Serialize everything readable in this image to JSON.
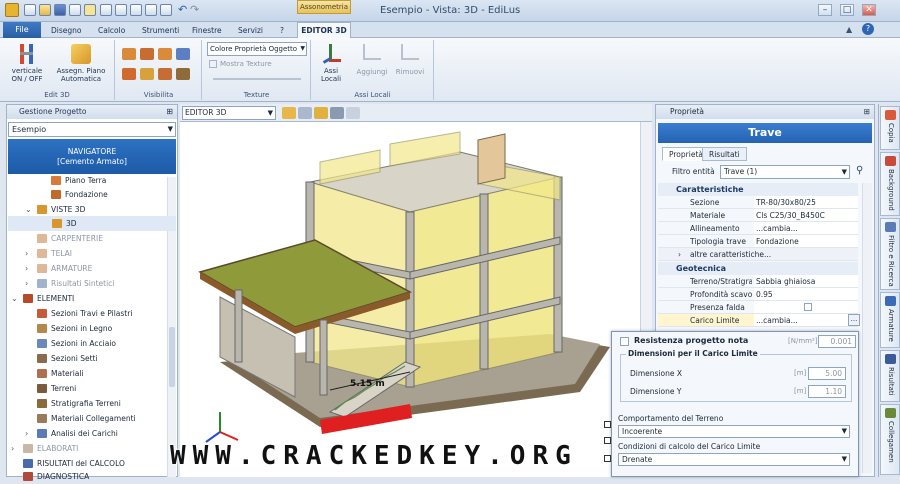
{
  "app": {
    "title": "Esempio - Vista: 3D - EdiLus",
    "context_tab": "Assonometria"
  },
  "menu_tabs": [
    "File",
    "Disegno",
    "Calcolo",
    "Strumenti",
    "Finestre",
    "Servizi",
    "?",
    "EDITOR 3D"
  ],
  "ribbon": {
    "edit3d": {
      "btn1": "verticale ON / OFF",
      "btn2": "Assegn. Piano Automatica",
      "label": "Edit 3D"
    },
    "visibilita": {
      "label": "Visibilita"
    },
    "texture": {
      "dropdown": "Colore Proprietà Oggetto",
      "check": "Mostra Texture",
      "label": "Texture"
    },
    "assi": {
      "btn1": "Assi Locali",
      "btn2": "Aggiungi",
      "btn3": "Rimuovi",
      "label": "Assi Locali"
    }
  },
  "left_panel": {
    "title": "Gestione Progetto",
    "selector": "Esempio",
    "navigator_line1": "NAVIGATORE",
    "navigator_line2": "[Cemento Armato]",
    "tree": {
      "piano_terra": "Piano Terra",
      "fondazione": "Fondazione",
      "viste3d": "VISTE 3D",
      "v3d": "3D",
      "carpenterie": "CARPENTERIE",
      "telai": "TELAI",
      "armature": "ARMATURE",
      "risultati_sintetici": "Risultati Sintetici",
      "elementi": "ELEMENTI",
      "sez_travi": "Sezioni Travi e Pilastri",
      "sez_legno": "Sezioni in Legno",
      "sez_acciaio": "Sezioni in Acciaio",
      "sez_setti": "Sezioni Setti",
      "materiali": "Materiali",
      "terreni": "Terreni",
      "stratigrafia": "Stratigrafia Terreni",
      "mat_collegamenti": "Materiali Collegamenti",
      "analisi_carichi": "Analisi dei Carichi",
      "elaborati": "ELABORATI",
      "risultati_calcolo": "RISULTATI del CALCOLO",
      "diagnostica": "DIAGNOSTICA"
    }
  },
  "viewport": {
    "selector": "EDITOR 3D",
    "dimension_label": "5.15 m"
  },
  "properties": {
    "panel_title": "Proprietà",
    "title": "Trave",
    "tabs": [
      "Proprietà",
      "Risultati"
    ],
    "filter_label": "Filtro entità",
    "filter_value": "Trave (1)",
    "section1": "Caratteristiche",
    "rows1": [
      {
        "k": "Sezione",
        "v": "TR-80/30x80/25"
      },
      {
        "k": "Materiale",
        "v": "Cls C25/30_B450C"
      },
      {
        "k": "Allineamento",
        "v": "...cambia..."
      },
      {
        "k": "Tipologia trave",
        "v": "Fondazione"
      }
    ],
    "more": "altre caratteristiche...",
    "section2": "Geotecnica",
    "rows2": [
      {
        "k": "Terreno/Stratigrafi",
        "v": "Sabbia ghiaiosa"
      },
      {
        "k": "Profondità scavo ri",
        "v": "0.95"
      },
      {
        "k": "Presenza falda",
        "v": ""
      },
      {
        "k": "Carico Limite",
        "v": "...cambia..."
      }
    ]
  },
  "popup": {
    "resistenza": "Resistenza progetto nota",
    "resistenza_unit": "[N/mm²]",
    "resistenza_val": "0.001",
    "group": "Dimensioni per il Carico Limite",
    "dimx": "Dimensione X",
    "dimx_unit": "[m]",
    "dimx_val": "5.00",
    "dimy": "Dimensione Y",
    "dimy_unit": "[m]",
    "dimy_val": "1.10",
    "comportamento": "Comportamento del Terreno",
    "comportamento_val": "Incoerente",
    "condizioni": "Condizioni di calcolo del Carico Limite",
    "condizioni_val": "Drenate"
  },
  "side_tabs": [
    "Copia",
    "Background",
    "Filtro e Ricerca",
    "Armature",
    "Risultati",
    "Collegamen"
  ],
  "watermark": "WWW.CRACKEDKEY.ORG",
  "colors": {
    "accent": "#2b6cc0",
    "wall_yellow": "#f2e88a",
    "slab": "#8f9a3a",
    "concrete": "#b9b6ad"
  }
}
